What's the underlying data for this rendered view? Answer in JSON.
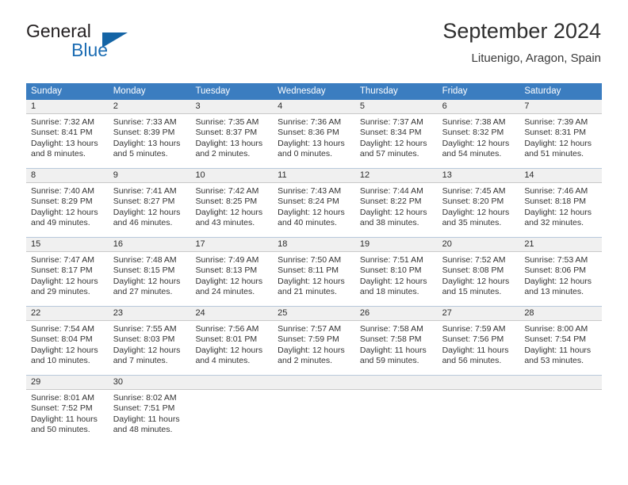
{
  "brand": {
    "name_part1": "General",
    "name_part2": "Blue",
    "triangle_color": "#1464a5",
    "blue_text_color": "#1b6cb3"
  },
  "header": {
    "title": "September 2024",
    "subtitle": "Lituenigo, Aragon, Spain"
  },
  "calendar": {
    "header_bg": "#3b7dc0",
    "daterow_bg": "#f0f0f0",
    "weekdays": [
      "Sunday",
      "Monday",
      "Tuesday",
      "Wednesday",
      "Thursday",
      "Friday",
      "Saturday"
    ],
    "weeks": [
      [
        {
          "day": "1",
          "sunrise": "Sunrise: 7:32 AM",
          "sunset": "Sunset: 8:41 PM",
          "daylight1": "Daylight: 13 hours",
          "daylight2": "and 8 minutes."
        },
        {
          "day": "2",
          "sunrise": "Sunrise: 7:33 AM",
          "sunset": "Sunset: 8:39 PM",
          "daylight1": "Daylight: 13 hours",
          "daylight2": "and 5 minutes."
        },
        {
          "day": "3",
          "sunrise": "Sunrise: 7:35 AM",
          "sunset": "Sunset: 8:37 PM",
          "daylight1": "Daylight: 13 hours",
          "daylight2": "and 2 minutes."
        },
        {
          "day": "4",
          "sunrise": "Sunrise: 7:36 AM",
          "sunset": "Sunset: 8:36 PM",
          "daylight1": "Daylight: 13 hours",
          "daylight2": "and 0 minutes."
        },
        {
          "day": "5",
          "sunrise": "Sunrise: 7:37 AM",
          "sunset": "Sunset: 8:34 PM",
          "daylight1": "Daylight: 12 hours",
          "daylight2": "and 57 minutes."
        },
        {
          "day": "6",
          "sunrise": "Sunrise: 7:38 AM",
          "sunset": "Sunset: 8:32 PM",
          "daylight1": "Daylight: 12 hours",
          "daylight2": "and 54 minutes."
        },
        {
          "day": "7",
          "sunrise": "Sunrise: 7:39 AM",
          "sunset": "Sunset: 8:31 PM",
          "daylight1": "Daylight: 12 hours",
          "daylight2": "and 51 minutes."
        }
      ],
      [
        {
          "day": "8",
          "sunrise": "Sunrise: 7:40 AM",
          "sunset": "Sunset: 8:29 PM",
          "daylight1": "Daylight: 12 hours",
          "daylight2": "and 49 minutes."
        },
        {
          "day": "9",
          "sunrise": "Sunrise: 7:41 AM",
          "sunset": "Sunset: 8:27 PM",
          "daylight1": "Daylight: 12 hours",
          "daylight2": "and 46 minutes."
        },
        {
          "day": "10",
          "sunrise": "Sunrise: 7:42 AM",
          "sunset": "Sunset: 8:25 PM",
          "daylight1": "Daylight: 12 hours",
          "daylight2": "and 43 minutes."
        },
        {
          "day": "11",
          "sunrise": "Sunrise: 7:43 AM",
          "sunset": "Sunset: 8:24 PM",
          "daylight1": "Daylight: 12 hours",
          "daylight2": "and 40 minutes."
        },
        {
          "day": "12",
          "sunrise": "Sunrise: 7:44 AM",
          "sunset": "Sunset: 8:22 PM",
          "daylight1": "Daylight: 12 hours",
          "daylight2": "and 38 minutes."
        },
        {
          "day": "13",
          "sunrise": "Sunrise: 7:45 AM",
          "sunset": "Sunset: 8:20 PM",
          "daylight1": "Daylight: 12 hours",
          "daylight2": "and 35 minutes."
        },
        {
          "day": "14",
          "sunrise": "Sunrise: 7:46 AM",
          "sunset": "Sunset: 8:18 PM",
          "daylight1": "Daylight: 12 hours",
          "daylight2": "and 32 minutes."
        }
      ],
      [
        {
          "day": "15",
          "sunrise": "Sunrise: 7:47 AM",
          "sunset": "Sunset: 8:17 PM",
          "daylight1": "Daylight: 12 hours",
          "daylight2": "and 29 minutes."
        },
        {
          "day": "16",
          "sunrise": "Sunrise: 7:48 AM",
          "sunset": "Sunset: 8:15 PM",
          "daylight1": "Daylight: 12 hours",
          "daylight2": "and 27 minutes."
        },
        {
          "day": "17",
          "sunrise": "Sunrise: 7:49 AM",
          "sunset": "Sunset: 8:13 PM",
          "daylight1": "Daylight: 12 hours",
          "daylight2": "and 24 minutes."
        },
        {
          "day": "18",
          "sunrise": "Sunrise: 7:50 AM",
          "sunset": "Sunset: 8:11 PM",
          "daylight1": "Daylight: 12 hours",
          "daylight2": "and 21 minutes."
        },
        {
          "day": "19",
          "sunrise": "Sunrise: 7:51 AM",
          "sunset": "Sunset: 8:10 PM",
          "daylight1": "Daylight: 12 hours",
          "daylight2": "and 18 minutes."
        },
        {
          "day": "20",
          "sunrise": "Sunrise: 7:52 AM",
          "sunset": "Sunset: 8:08 PM",
          "daylight1": "Daylight: 12 hours",
          "daylight2": "and 15 minutes."
        },
        {
          "day": "21",
          "sunrise": "Sunrise: 7:53 AM",
          "sunset": "Sunset: 8:06 PM",
          "daylight1": "Daylight: 12 hours",
          "daylight2": "and 13 minutes."
        }
      ],
      [
        {
          "day": "22",
          "sunrise": "Sunrise: 7:54 AM",
          "sunset": "Sunset: 8:04 PM",
          "daylight1": "Daylight: 12 hours",
          "daylight2": "and 10 minutes."
        },
        {
          "day": "23",
          "sunrise": "Sunrise: 7:55 AM",
          "sunset": "Sunset: 8:03 PM",
          "daylight1": "Daylight: 12 hours",
          "daylight2": "and 7 minutes."
        },
        {
          "day": "24",
          "sunrise": "Sunrise: 7:56 AM",
          "sunset": "Sunset: 8:01 PM",
          "daylight1": "Daylight: 12 hours",
          "daylight2": "and 4 minutes."
        },
        {
          "day": "25",
          "sunrise": "Sunrise: 7:57 AM",
          "sunset": "Sunset: 7:59 PM",
          "daylight1": "Daylight: 12 hours",
          "daylight2": "and 2 minutes."
        },
        {
          "day": "26",
          "sunrise": "Sunrise: 7:58 AM",
          "sunset": "Sunset: 7:58 PM",
          "daylight1": "Daylight: 11 hours",
          "daylight2": "and 59 minutes."
        },
        {
          "day": "27",
          "sunrise": "Sunrise: 7:59 AM",
          "sunset": "Sunset: 7:56 PM",
          "daylight1": "Daylight: 11 hours",
          "daylight2": "and 56 minutes."
        },
        {
          "day": "28",
          "sunrise": "Sunrise: 8:00 AM",
          "sunset": "Sunset: 7:54 PM",
          "daylight1": "Daylight: 11 hours",
          "daylight2": "and 53 minutes."
        }
      ],
      [
        {
          "day": "29",
          "sunrise": "Sunrise: 8:01 AM",
          "sunset": "Sunset: 7:52 PM",
          "daylight1": "Daylight: 11 hours",
          "daylight2": "and 50 minutes."
        },
        {
          "day": "30",
          "sunrise": "Sunrise: 8:02 AM",
          "sunset": "Sunset: 7:51 PM",
          "daylight1": "Daylight: 11 hours",
          "daylight2": "and 48 minutes."
        },
        {
          "day": "",
          "sunrise": "",
          "sunset": "",
          "daylight1": "",
          "daylight2": ""
        },
        {
          "day": "",
          "sunrise": "",
          "sunset": "",
          "daylight1": "",
          "daylight2": ""
        },
        {
          "day": "",
          "sunrise": "",
          "sunset": "",
          "daylight1": "",
          "daylight2": ""
        },
        {
          "day": "",
          "sunrise": "",
          "sunset": "",
          "daylight1": "",
          "daylight2": ""
        },
        {
          "day": "",
          "sunrise": "",
          "sunset": "",
          "daylight1": "",
          "daylight2": ""
        }
      ]
    ]
  }
}
